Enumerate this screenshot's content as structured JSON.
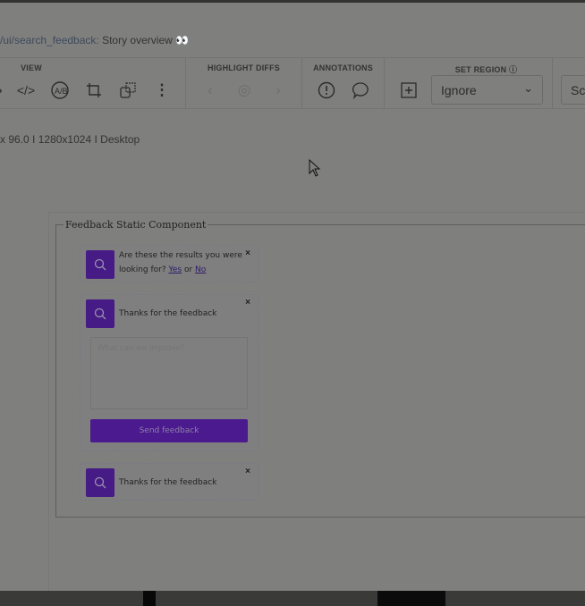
{
  "breadcrumb": {
    "path": "/ui/search_feedback:",
    "title": "Story overview",
    "icon": "eyes-icon"
  },
  "toolbar": {
    "view_label": "VIEW",
    "highlight_label": "HIGHLIGHT DIFFS",
    "annotations_label": "ANNOTATIONS",
    "set_region_label": "SET REGION",
    "region_value": "Ignore",
    "next_select_value": "Sc"
  },
  "info": {
    "zoom": "x 96.0",
    "sep": "I",
    "resolution": "1280x1024",
    "device": "Desktop"
  },
  "story": {
    "legend": "Feedback Static Component",
    "card1": {
      "question": "Are these the results you were looking for?",
      "yes": "Yes",
      "or": "or",
      "no": "No"
    },
    "card2": {
      "text": "Thanks for the feedback",
      "placeholder": "What can we improve?",
      "button": "Send feedback"
    },
    "card3": {
      "text": "Thanks for the feedback"
    },
    "close": "×"
  }
}
